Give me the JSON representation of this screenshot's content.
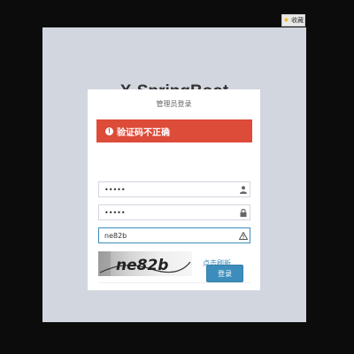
{
  "bookmark": {
    "label": "收藏",
    "icon": "star-icon"
  },
  "app": {
    "title": "X-SpringBoot"
  },
  "login": {
    "heading": "管理员登录",
    "alert": {
      "message": "验证码不正确",
      "icon": "exclamation-circle-icon",
      "color": "#dd4b39"
    },
    "username": {
      "value": "•••••",
      "icon": "user-icon"
    },
    "password": {
      "value": "•••••",
      "icon": "lock-icon"
    },
    "captcha_input": {
      "value": "ne82b",
      "icon": "warning-icon"
    },
    "captcha_image_text": "ne82b",
    "refresh_label": "点击刷新",
    "submit_label": "登录"
  },
  "colors": {
    "primary": "#3c8dbc",
    "danger": "#dd4b39",
    "page_bg": "#d2d6de",
    "outer_bg": "#0c0c0c"
  }
}
